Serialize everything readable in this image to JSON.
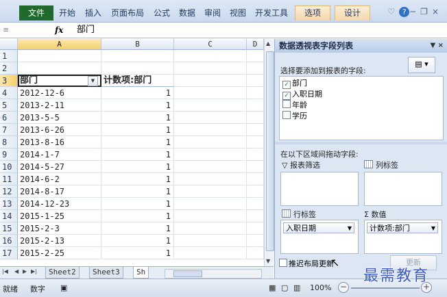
{
  "ribbon": {
    "file_tab": "文件",
    "tabs": [
      "开始",
      "插入",
      "页面布局",
      "公式",
      "数据",
      "审阅",
      "视图",
      "开发工具"
    ],
    "context_tabs": [
      "选项",
      "设计"
    ]
  },
  "formula_bar": {
    "fx": "fx",
    "value": "部门"
  },
  "columns": [
    "A",
    "B",
    "C",
    "D"
  ],
  "rows": [
    "1",
    "2",
    "3",
    "4",
    "5",
    "6",
    "7",
    "8",
    "9",
    "10",
    "11",
    "12",
    "13",
    "14",
    "15",
    "16",
    "17"
  ],
  "pivot": {
    "header_a": "部门",
    "header_b": "计数项:部门",
    "data": [
      [
        "2012-12-6",
        "1"
      ],
      [
        "2013-2-11",
        "1"
      ],
      [
        "2013-5-5",
        "1"
      ],
      [
        "2013-6-26",
        "1"
      ],
      [
        "2013-8-16",
        "1"
      ],
      [
        "2014-1-7",
        "1"
      ],
      [
        "2014-5-27",
        "1"
      ],
      [
        "2014-6-2",
        "1"
      ],
      [
        "2014-8-17",
        "1"
      ],
      [
        "2014-12-23",
        "1"
      ],
      [
        "2015-1-25",
        "1"
      ],
      [
        "2015-2-3",
        "1"
      ],
      [
        "2015-2-13",
        "1"
      ],
      [
        "2015-2-25",
        "1"
      ]
    ]
  },
  "sheets": [
    "Sheet2",
    "Sheet3",
    "Sh"
  ],
  "status": {
    "ready": "就绪",
    "mode": "数字",
    "zoom": "100%"
  },
  "panel": {
    "title": "数据透视表字段列表",
    "choose_label": "选择要添加到报表的字段:",
    "fields": [
      {
        "label": "部门",
        "checked": true
      },
      {
        "label": "入职日期",
        "checked": true
      },
      {
        "label": "年龄",
        "checked": false
      },
      {
        "label": "学历",
        "checked": false
      }
    ],
    "drag_label": "在以下区域间拖动字段:",
    "filter_label": "报表筛选",
    "column_label": "列标签",
    "row_label": "行标签",
    "values_label": "数值",
    "row_chip": "入职日期",
    "values_chip": "计数项:部门",
    "sigma": "Σ",
    "defer_label": "推迟布局更新",
    "update_button": "更新"
  },
  "watermark": "最需教育"
}
